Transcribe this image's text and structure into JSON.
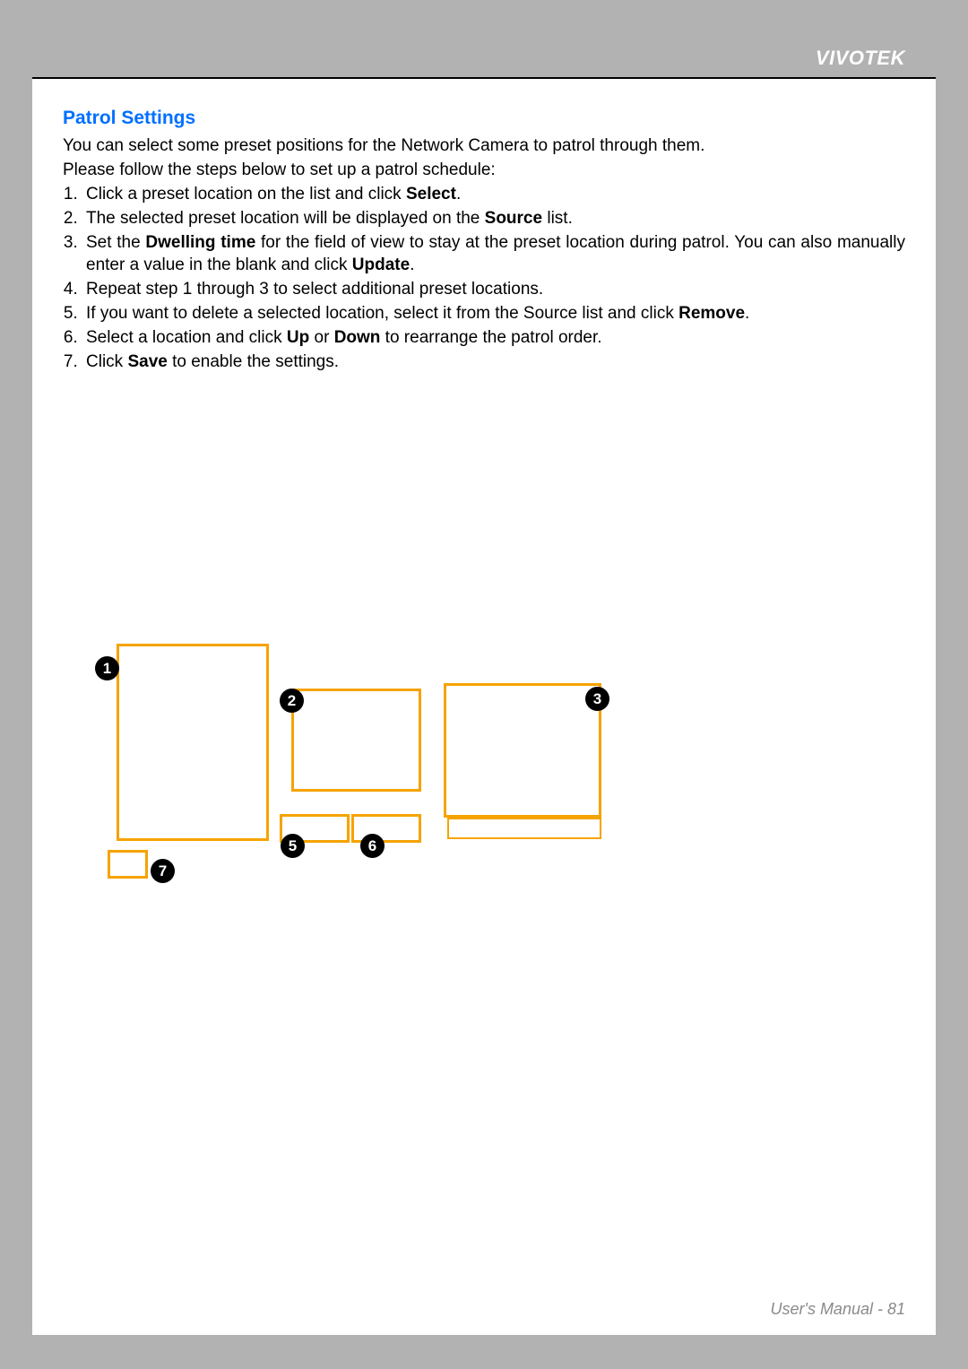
{
  "brand": "VIVOTEK",
  "section": {
    "title": "Patrol Settings",
    "intro1": "You can select some preset positions for the Network Camera to patrol through them.",
    "intro2": "Please follow the steps below to set up a patrol schedule:",
    "steps": [
      {
        "pre": "Click a preset location on the list and click ",
        "bold1": "Select",
        "post": "."
      },
      {
        "pre": "The selected preset location will be displayed on the ",
        "bold1": "Source",
        "post": " list."
      },
      {
        "pre": "Set the ",
        "bold1": "Dwelling time",
        "mid": " for the field of view to stay at the preset location during patrol. You can also manually enter a value in the blank and click ",
        "bold2": "Update",
        "post": "."
      },
      {
        "pre": "Repeat step 1 through 3 to select additional preset locations."
      },
      {
        "pre": "If you want to delete a selected location, select it from the Source list and click ",
        "bold1": "Remove",
        "post": "."
      },
      {
        "pre": "Select a location and click ",
        "bold1": "Up",
        "mid": " or ",
        "bold2": "Down",
        "post": " to rearrange the patrol order."
      },
      {
        "pre": "Click ",
        "bold1": "Save",
        "post": " to enable the settings."
      }
    ]
  },
  "diagram": {
    "callouts": {
      "1": "1",
      "2": "2",
      "3": "3",
      "5": "5",
      "6": "6",
      "7": "7"
    }
  },
  "footer": "User's Manual - 81"
}
